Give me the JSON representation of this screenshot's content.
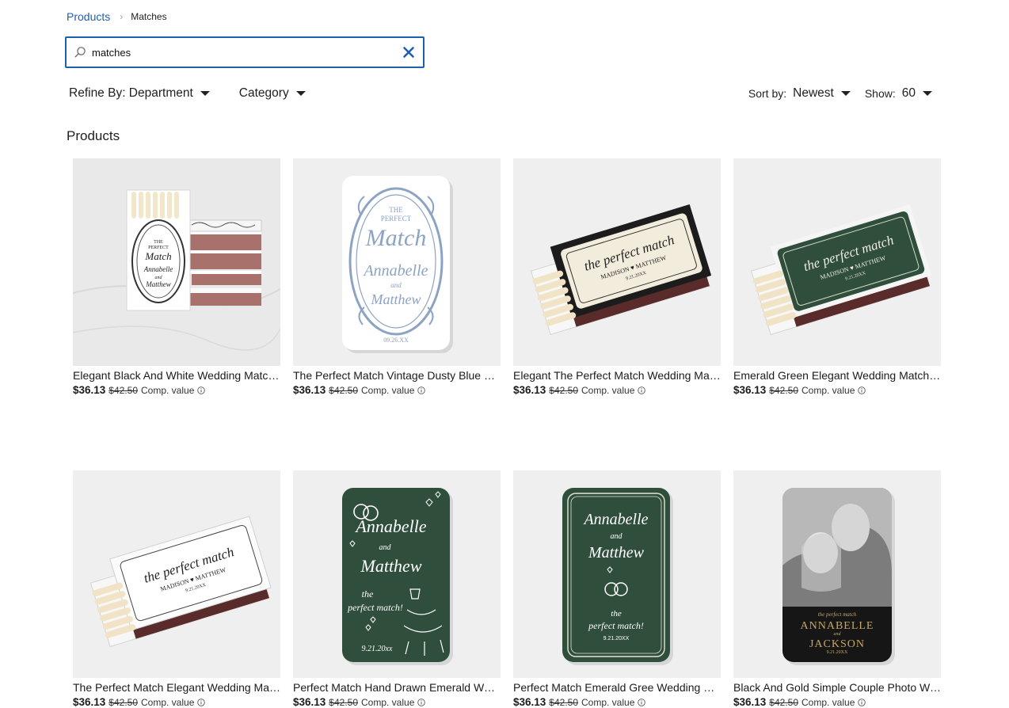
{
  "breadcrumb": {
    "parent": "Products",
    "current": "Matches"
  },
  "search": {
    "value": "matches"
  },
  "filters": {
    "department": "Refine By: Department",
    "category": "Category"
  },
  "sort": {
    "sort_label": "Sort by:",
    "sort_value": "Newest",
    "show_label": "Show:",
    "show_value": "60"
  },
  "section_title": "Products",
  "colors": {
    "accent": "#1f5fb0",
    "emerald": "#2f4f3c",
    "tile_bg": "#efefef"
  },
  "products": [
    {
      "title": "Elegant Black And White Wedding Matchbox",
      "price": "$36.13",
      "old_price": "$42.50",
      "comp": "Comp. value"
    },
    {
      "title": "The Perfect Match Vintage Dusty Blue Wedding Matchbox",
      "price": "$36.13",
      "old_price": "$42.50",
      "comp": "Comp. value"
    },
    {
      "title": "Elegant The Perfect Match Wedding Matchbox",
      "price": "$36.13",
      "old_price": "$42.50",
      "comp": "Comp. value"
    },
    {
      "title": "Emerald Green Elegant Wedding Matchbox",
      "price": "$36.13",
      "old_price": "$42.50",
      "comp": "Comp. value"
    },
    {
      "title": "The Perfect Match Elegant Wedding Matchbox",
      "price": "$36.13",
      "old_price": "$42.50",
      "comp": "Comp. value"
    },
    {
      "title": "Perfect Match Hand Drawn Emerald Wedding Matchbox",
      "price": "$36.13",
      "old_price": "$42.50",
      "comp": "Comp. value"
    },
    {
      "title": "Perfect Match Emerald Gree Wedding Matchbox",
      "price": "$36.13",
      "old_price": "$42.50",
      "comp": "Comp. value"
    },
    {
      "title": "Black And Gold Simple Couple Photo Wedding Matchbox",
      "price": "$36.13",
      "old_price": "$42.50",
      "comp": "Comp. value"
    }
  ],
  "artwork": {
    "p1": {
      "line1": "THE",
      "line2": "PERFECT",
      "line3": "Match",
      "line4": "Annabelle",
      "line5": "and",
      "line6": "Matthew"
    },
    "p2": {
      "line1": "THE",
      "line2": "PERFECT",
      "line3": "Match",
      "line4": "Annabelle",
      "line5": "and",
      "line6": "Matthew",
      "date": "09.26.XX"
    },
    "p3": {
      "script": "the perfect match",
      "names": "MADISON ♥ MATTHEW",
      "date": "9.21.20XX"
    },
    "p4": {
      "script": "the perfect match",
      "names": "MADISON ♥ MATTHEW",
      "date": "9.21.20XX"
    },
    "p5": {
      "script": "the perfect match",
      "names": "MADISON ♥ MATTHEW",
      "date": "9.21.20XX"
    },
    "p6": {
      "line1": "Annabelle",
      "line2": "and",
      "line3": "Matthew",
      "line4": "the",
      "line5": "perfect match!",
      "date": "9.21.20xx"
    },
    "p7": {
      "line1": "Annabelle",
      "line2": "and",
      "line3": "Matthew",
      "line4": "the",
      "line5": "perfect match!",
      "date": "9.21.20XX"
    },
    "p8": {
      "script": "the perfect match",
      "name1": "ANNABELLE",
      "and": "and",
      "name2": "JACKSON",
      "date": "9.21.20XX"
    }
  }
}
